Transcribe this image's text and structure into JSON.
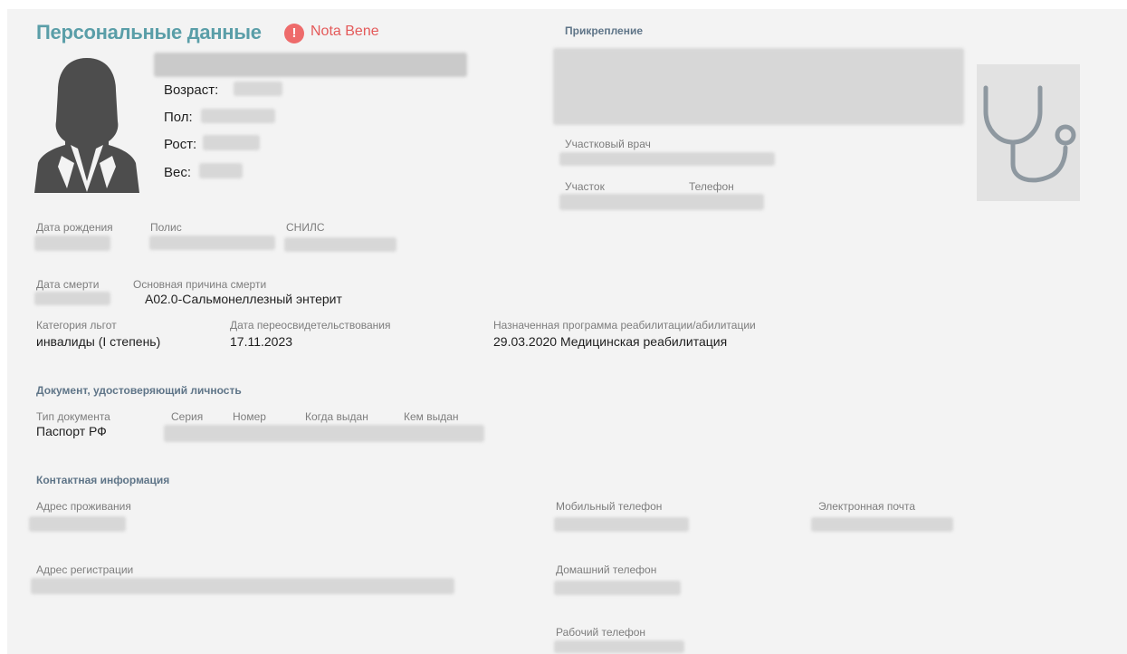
{
  "personal": {
    "title": "Персональные данные",
    "nota_bene": "Nota Bene",
    "age_label": "Возраст:",
    "sex_label": "Пол:",
    "height_label": "Рост:",
    "weight_label": "Вес:"
  },
  "ids": {
    "birth_date_label": "Дата рождения",
    "policy_label": "Полис",
    "snils_label": "СНИЛС"
  },
  "death": {
    "date_label": "Дата смерти",
    "cause_label": "Основная причина смерти",
    "cause_value": "A02.0-Сальмонеллезный энтерит"
  },
  "benefits": {
    "category_label": "Категория льгот",
    "category_value": "инвалиды (I степень)",
    "reexam_label": "Дата переосвидетельствования",
    "reexam_value": "17.11.2023",
    "program_label": "Назначенная программа реабилитации/абилитации",
    "program_value": "29.03.2020 Медицинская реабилитация"
  },
  "document": {
    "section_title": "Документ, удостоверяющий личность",
    "type_label": "Тип документа",
    "type_value": "Паспорт РФ",
    "series_label": "Серия",
    "number_label": "Номер",
    "issued_date_label": "Когда выдан",
    "issued_by_label": "Кем выдан"
  },
  "contacts": {
    "section_title": "Контактная информация",
    "residence_label": "Адрес проживания",
    "registration_label": "Адрес регистрации",
    "mobile_label": "Мобильный телефон",
    "home_phone_label": "Домашний телефон",
    "work_phone_label": "Рабочий телефон",
    "email_label": "Электронная почта"
  },
  "attachment": {
    "section_title": "Прикрепление",
    "doctor_label": "Участковый врач",
    "district_label": "Участок",
    "phone_label": "Телефон"
  },
  "icons": {
    "alert": "exclamation-icon",
    "avatar": "female-avatar-icon",
    "doctor": "stethoscope-icon"
  },
  "colors": {
    "title": "#5a9ea8",
    "nota_bene": "#e45a5a",
    "alert_icon": "#ee6b6b",
    "section": "#5f7588",
    "avatar": "#4d4d4d",
    "stethoscope": "#8e98a0"
  }
}
